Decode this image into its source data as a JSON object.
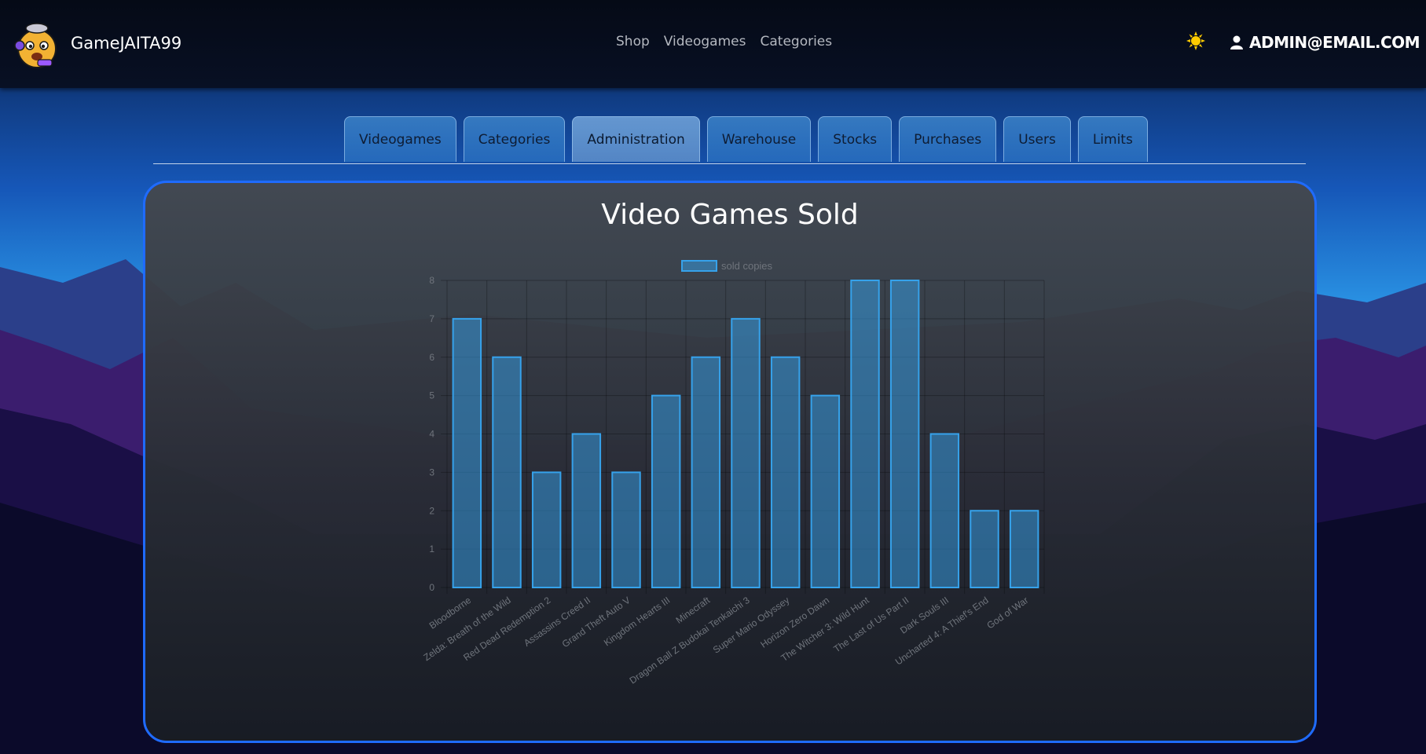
{
  "app": {
    "brand_name": "GameJAITA99",
    "nav_links": [
      "Shop",
      "Videogames",
      "Categories"
    ],
    "theme_icon": "sun-icon",
    "user_email": "ADMIN@EMAIL.COM"
  },
  "tabs": [
    {
      "label": "Videogames",
      "active": false
    },
    {
      "label": "Categories",
      "active": false
    },
    {
      "label": "Administration",
      "active": true
    },
    {
      "label": "Warehouse",
      "active": false
    },
    {
      "label": "Stocks",
      "active": false
    },
    {
      "label": "Purchases",
      "active": false
    },
    {
      "label": "Users",
      "active": false
    },
    {
      "label": "Limits",
      "active": false
    }
  ],
  "panel": {
    "title": "Video Games Sold"
  },
  "colors": {
    "accent_border": "#1f6bff",
    "bar_fill": "rgba(54,162,235,0.5)",
    "bar_stroke": "#36a2eb"
  },
  "chart_data": {
    "type": "bar",
    "title": "",
    "legend_position": "top",
    "grid": true,
    "categories": [
      "Bloodborne",
      "Zelda: Breath of the Wild",
      "Red Dead Redemption 2",
      "Assassins Creed II",
      "Grand Theft Auto V",
      "Kingdom Hearts III",
      "Minecraft",
      "Dragon Ball Z Budokai Tenkaichi 3",
      "Super Mario Odyssey",
      "Horizon Zero Dawn",
      "The Witcher 3: Wild Hunt",
      "The Last of Us Part II",
      "Dark Souls III",
      "Uncharted 4: A Thief's End",
      "God of War"
    ],
    "series": [
      {
        "name": "sold copies",
        "values": [
          7,
          6,
          3,
          4,
          3,
          5,
          6,
          7,
          6,
          5,
          8,
          8,
          4,
          2,
          2
        ]
      }
    ],
    "ylim": [
      0,
      8
    ],
    "yticks": [
      0,
      1,
      2,
      3,
      4,
      5,
      6,
      7,
      8
    ]
  }
}
